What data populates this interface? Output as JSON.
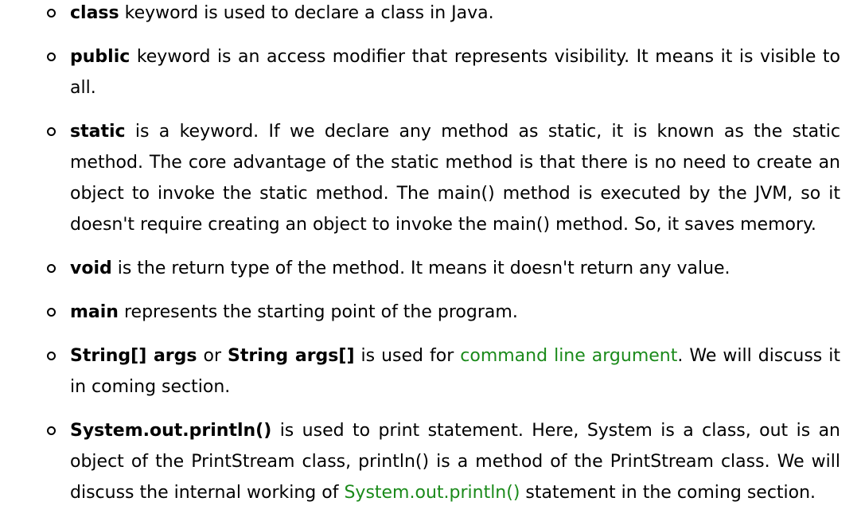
{
  "items": [
    {
      "parts": [
        {
          "type": "bold",
          "text": "class"
        },
        {
          "type": "text",
          "text": " keyword is used to declare a class in Java."
        }
      ]
    },
    {
      "parts": [
        {
          "type": "bold",
          "text": "public"
        },
        {
          "type": "text",
          "text": " keyword is an access modifier that represents visibility. It means it is visible to all."
        }
      ]
    },
    {
      "parts": [
        {
          "type": "bold",
          "text": "static"
        },
        {
          "type": "text",
          "text": " is a keyword. If we declare any method as static, it is known as the static method. The core advantage of the static method is that there is no need to create an object to invoke the static method. The main() method is executed by the JVM, so it doesn't require creating an object to invoke the main() method. So, it saves memory."
        }
      ]
    },
    {
      "parts": [
        {
          "type": "bold",
          "text": "void"
        },
        {
          "type": "text",
          "text": " is the return type of the method. It means it doesn't return any value."
        }
      ]
    },
    {
      "parts": [
        {
          "type": "bold",
          "text": "main"
        },
        {
          "type": "text",
          "text": " represents the starting point of the program."
        }
      ]
    },
    {
      "parts": [
        {
          "type": "bold",
          "text": "String[] args"
        },
        {
          "type": "text",
          "text": " or "
        },
        {
          "type": "bold",
          "text": "String args[]"
        },
        {
          "type": "text",
          "text": " is used for "
        },
        {
          "type": "link",
          "text": "command line argument"
        },
        {
          "type": "text",
          "text": ". We will discuss it in coming section."
        }
      ]
    },
    {
      "parts": [
        {
          "type": "bold",
          "text": "System.out.println()"
        },
        {
          "type": "text",
          "text": " is used to print statement. Here, System is a class, out is an object of the PrintStream class, println() is a method of the PrintStream class. We will discuss the internal working of "
        },
        {
          "type": "link",
          "text": "System.out.println()"
        },
        {
          "type": "text",
          "text": " statement in the coming section."
        }
      ]
    }
  ],
  "colors": {
    "link": "#1a8a1a",
    "text": "#000000",
    "background": "#ffffff"
  }
}
